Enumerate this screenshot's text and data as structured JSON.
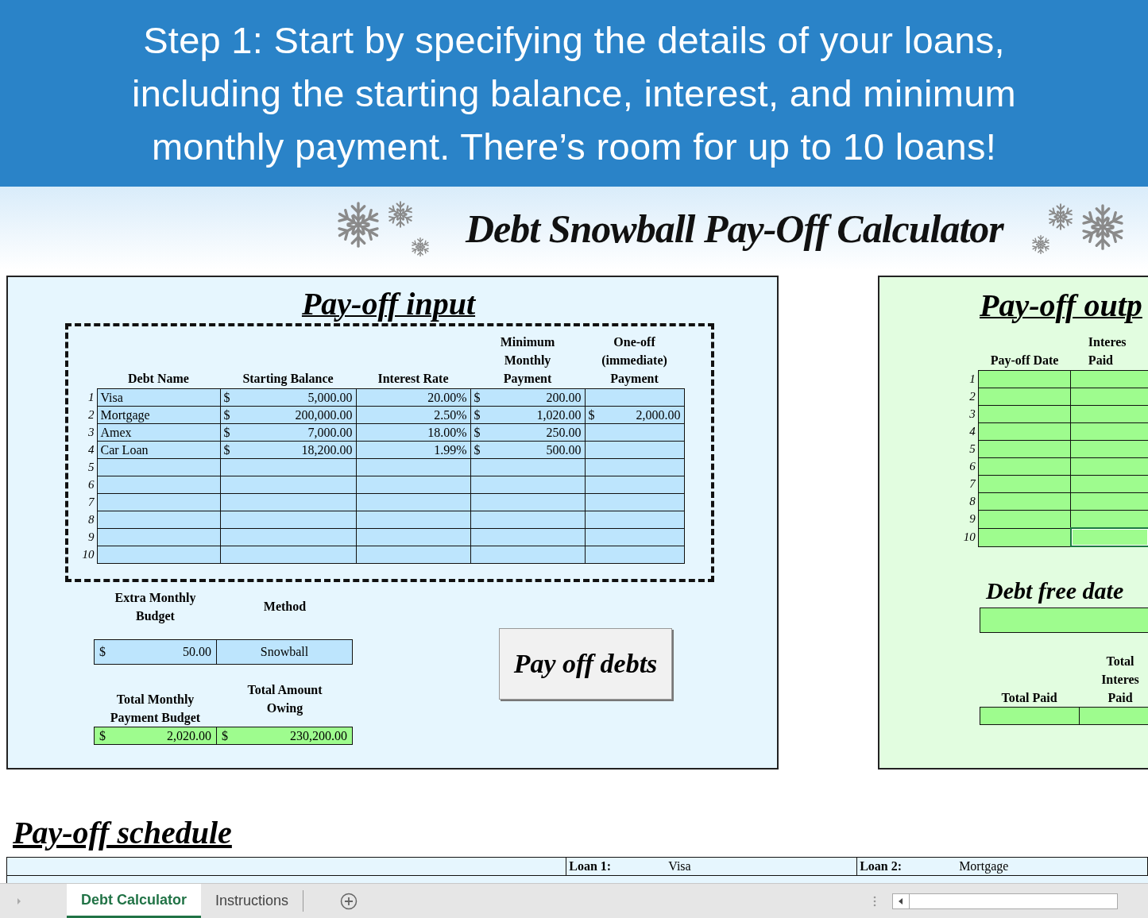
{
  "banner": {
    "lines": [
      "Step 1: Start by specifying the details of your loans,",
      "including the starting balance, interest, and minimum",
      "monthly payment. There’s room for up to 10 loans!"
    ]
  },
  "title": "Debt Snowball Pay-Off Calculator",
  "input_panel": {
    "title": "Pay-off input",
    "columns": [
      "Debt Name",
      "Starting Balance",
      "Interest Rate",
      "Minimum Monthly Payment",
      "One-off (immediate) Payment"
    ],
    "rows": [
      {
        "num": "1",
        "name": "Visa",
        "balance": {
          "symbol": "$",
          "amount": "5,000.00"
        },
        "rate": "20.00%",
        "min_payment": {
          "symbol": "$",
          "amount": "200.00"
        }
      },
      {
        "num": "2",
        "name": "Mortgage",
        "balance": {
          "symbol": "$",
          "amount": "200,000.00"
        },
        "rate": "2.50%",
        "min_payment": {
          "symbol": "$",
          "amount": "1,020.00"
        },
        "one_off": {
          "symbol": "$",
          "amount": "2,000.00"
        }
      },
      {
        "num": "3",
        "name": "Amex",
        "balance": {
          "symbol": "$",
          "amount": "7,000.00"
        },
        "rate": "18.00%",
        "min_payment": {
          "symbol": "$",
          "amount": "250.00"
        }
      },
      {
        "num": "4",
        "name": "Car Loan",
        "balance": {
          "symbol": "$",
          "amount": "18,200.00"
        },
        "rate": "1.99%",
        "min_payment": {
          "symbol": "$",
          "amount": "500.00"
        }
      },
      {
        "num": "5"
      },
      {
        "num": "6"
      },
      {
        "num": "7"
      },
      {
        "num": "8"
      },
      {
        "num": "9"
      },
      {
        "num": "10"
      }
    ],
    "extra_budget": {
      "label": "Extra Monthly Budget",
      "value": {
        "symbol": "$",
        "amount": "50.00"
      }
    },
    "method": {
      "label": "Method",
      "value": "Snowball"
    },
    "total_budget": {
      "label": "Total Monthly Payment Budget",
      "value": {
        "symbol": "$",
        "amount": "2,020.00"
      }
    },
    "total_owing": {
      "label": "Total Amount Owing",
      "value": {
        "symbol": "$",
        "amount": "230,200.00"
      }
    },
    "button": "Pay off debts"
  },
  "output_panel": {
    "title": "Pay-off outp",
    "columns": [
      "Pay-off Date",
      "Interes Paid"
    ],
    "rows": [
      {
        "num": "1",
        "selected": false
      },
      {
        "num": "2",
        "selected": false
      },
      {
        "num": "3",
        "selected": false
      },
      {
        "num": "4",
        "selected": false
      },
      {
        "num": "5",
        "selected": false
      },
      {
        "num": "6",
        "selected": false
      },
      {
        "num": "7",
        "selected": false
      },
      {
        "num": "8",
        "selected": false
      },
      {
        "num": "9",
        "selected": false
      },
      {
        "num": "10",
        "selected": true
      }
    ],
    "debt_free_title": "Debt free date",
    "totals": [
      "Total Paid",
      "Total Interes Paid"
    ]
  },
  "schedule": {
    "title": "Pay-off schedule",
    "loans": [
      {
        "label": "Loan 1:",
        "name": "Visa"
      },
      {
        "label": "Loan 2:",
        "name": "Mortgage"
      }
    ]
  },
  "sheet_tabs": [
    {
      "label": "Debt Calculator",
      "selected": true
    },
    {
      "label": "Instructions",
      "selected": false
    }
  ]
}
